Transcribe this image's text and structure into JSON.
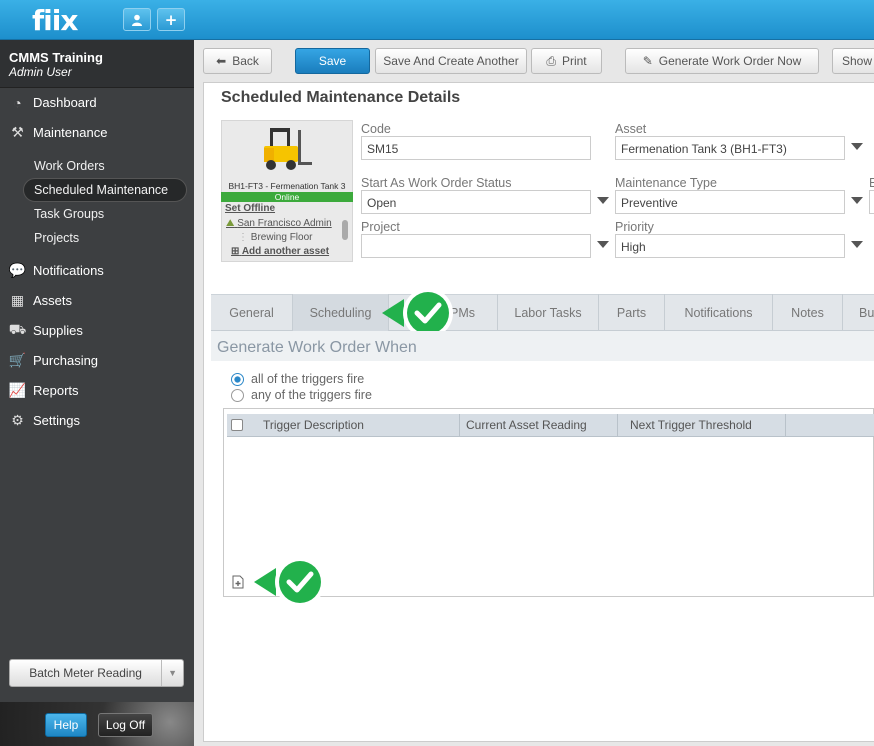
{
  "app": {
    "logo": "fiix"
  },
  "topbar": {
    "user_icon": "user-icon",
    "add_label": "+"
  },
  "sidebar": {
    "org_name": "CMMS Training",
    "user_role": "Admin User",
    "nav": [
      {
        "label": "Dashboard",
        "icon": "dashboard-icon"
      },
      {
        "label": "Maintenance",
        "icon": "tools-icon"
      },
      {
        "label": "Notifications",
        "icon": "chat-icon"
      },
      {
        "label": "Assets",
        "icon": "boxes-icon"
      },
      {
        "label": "Supplies",
        "icon": "truck-icon"
      },
      {
        "label": "Purchasing",
        "icon": "cart-icon"
      },
      {
        "label": "Reports",
        "icon": "chart-icon"
      },
      {
        "label": "Settings",
        "icon": "gear-icon"
      }
    ],
    "sub": [
      "Work Orders",
      "Scheduled Maintenance",
      "Task Groups",
      "Projects"
    ],
    "batch_label": "Batch Meter Reading",
    "help_label": "Help",
    "logoff_label": "Log Off"
  },
  "toolbar": {
    "back": "Back",
    "save": "Save",
    "save_another": "Save And Create Another",
    "print": "Print",
    "generate": "Generate Work Order Now",
    "show": "Show"
  },
  "page": {
    "title": "Scheduled Maintenance Details"
  },
  "asset_card": {
    "name": "BH1-FT3 - Fermenation Tank 3",
    "status": "Online",
    "set_offline": "Set Offline",
    "location": "San Francisco Admin",
    "sublocation": "Brewing Floor",
    "add_asset": "Add another asset"
  },
  "form": {
    "code_label": "Code",
    "code_value": "SM15",
    "asset_label": "Asset",
    "asset_value": "Fermenation Tank 3 (BH1-FT3)",
    "status_label": "Start As Work Order Status",
    "status_value": "Open",
    "mtype_label": "Maintenance Type",
    "mtype_value": "Preventive",
    "project_label": "Project",
    "project_value": "",
    "priority_label": "Priority",
    "priority_value": "High",
    "extra_label": "E"
  },
  "tabs": [
    "General",
    "Scheduling",
    "PMs",
    "Labor Tasks",
    "Parts",
    "Notifications",
    "Notes",
    "Bu"
  ],
  "scheduling": {
    "section_title": "Generate Work Order When",
    "option_all": "all of the triggers fire",
    "option_any": "any of the triggers fire",
    "selected": "all of the triggers fire",
    "columns": [
      "Trigger Description",
      "Current Asset Reading",
      "Next Trigger Threshold"
    ],
    "rows": []
  },
  "colors": {
    "accent": "#1d8fcc",
    "check_badge": "#22b14c",
    "sidebar": "#3d3f41"
  }
}
